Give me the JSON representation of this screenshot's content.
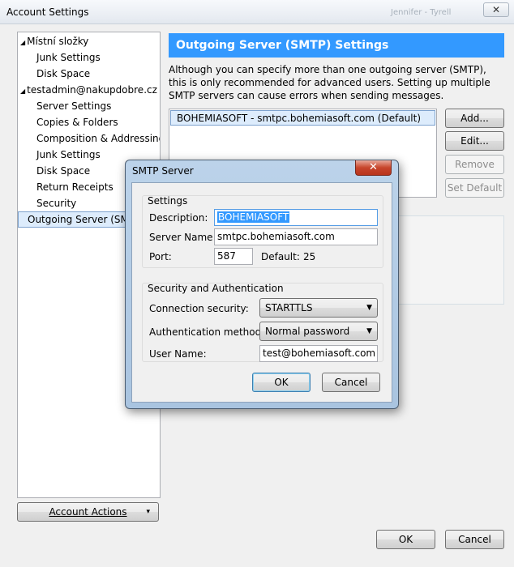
{
  "window": {
    "title": "Account Settings",
    "faded_title": "Jennifer - Tyrell"
  },
  "tree": {
    "items": [
      {
        "label": "Místní složky",
        "level": 0
      },
      {
        "label": "Junk Settings",
        "level": 1
      },
      {
        "label": "Disk Space",
        "level": 1
      },
      {
        "label": "testadmin@nakupdobre.cz",
        "level": 0
      },
      {
        "label": "Server Settings",
        "level": 1
      },
      {
        "label": "Copies & Folders",
        "level": 1
      },
      {
        "label": "Composition & Addressing",
        "level": 1
      },
      {
        "label": "Junk Settings",
        "level": 1
      },
      {
        "label": "Disk Space",
        "level": 1
      },
      {
        "label": "Return Receipts",
        "level": 1
      },
      {
        "label": "Security",
        "level": 1
      },
      {
        "label": "Outgoing Server (SMTP)",
        "level": 1,
        "selected": true
      }
    ],
    "expand_glyph": "◢"
  },
  "account_actions": {
    "label": "Account Actions",
    "arrow": "▾"
  },
  "smtp_panel": {
    "title": "Outgoing Server (SMTP) Settings",
    "description": "Although you can specify more than one outgoing server (SMTP), this is only recommended for advanced users. Setting up multiple SMTP servers can cause errors when sending messages.",
    "servers": [
      "BOHEMIASOFT - smtpc.bohemiasoft.com (Default)"
    ],
    "buttons": {
      "add": "Add...",
      "edit": "Edit...",
      "remove": "Remove",
      "set_default": "Set Default"
    }
  },
  "footer": {
    "ok": "OK",
    "cancel": "Cancel"
  },
  "dialog": {
    "title": "SMTP Server",
    "close_glyph": "✕",
    "settings_group": "Settings",
    "description_label": "Description:",
    "description_value": "BOHEMIASOFT",
    "server_name_label": "Server Name:",
    "server_name_value": "smtpc.bohemiasoft.com",
    "port_label": "Port:",
    "port_value": "587",
    "default_label": "Default:",
    "default_value": "25",
    "security_group": "Security and Authentication",
    "connection_security_label": "Connection security:",
    "connection_security_value": "STARTTLS",
    "auth_method_label": "Authentication method:",
    "auth_method_value": "Normal password",
    "user_name_label": "User Name:",
    "user_name_value": "test@bohemiasoft.com",
    "ok": "OK",
    "cancel": "Cancel",
    "dropdown_arrow": "▼"
  }
}
